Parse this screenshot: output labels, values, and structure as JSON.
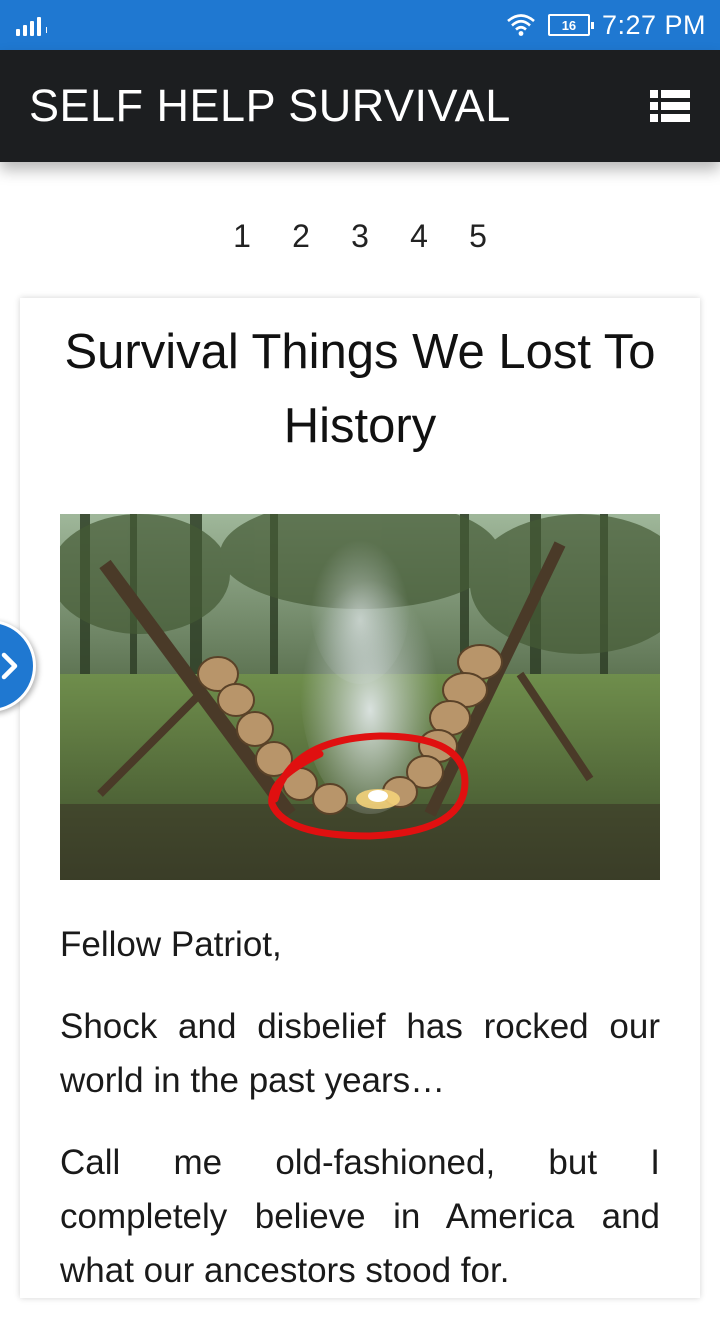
{
  "status_bar": {
    "time": "7:27 PM",
    "battery_level": "16",
    "signal_icon": "signal-icon",
    "wifi_icon": "wifi-icon",
    "battery_icon": "battery-icon"
  },
  "app_bar": {
    "title": "SELF HELP SURVIVAL",
    "menu_icon": "list-menu-icon",
    "background": "#1c1e20"
  },
  "pagination": {
    "pages": [
      "1",
      "2",
      "3",
      "4",
      "5"
    ]
  },
  "article": {
    "title": "Survival Things We Lost To History",
    "image_icon": "campfire-photo",
    "paragraphs": [
      "Fellow Patriot,",
      "Shock and disbelief has rocked our world in the past years…",
      "Call me old-fashioned, but I completely believe in America and what our ancestors stood for."
    ]
  },
  "side_tab": {
    "icon": "chevron-right-icon",
    "color": "#1f78d1"
  },
  "colors": {
    "status_bar": "#1f78d1",
    "accent": "#1f78d1",
    "circle_highlight": "#e01010"
  }
}
